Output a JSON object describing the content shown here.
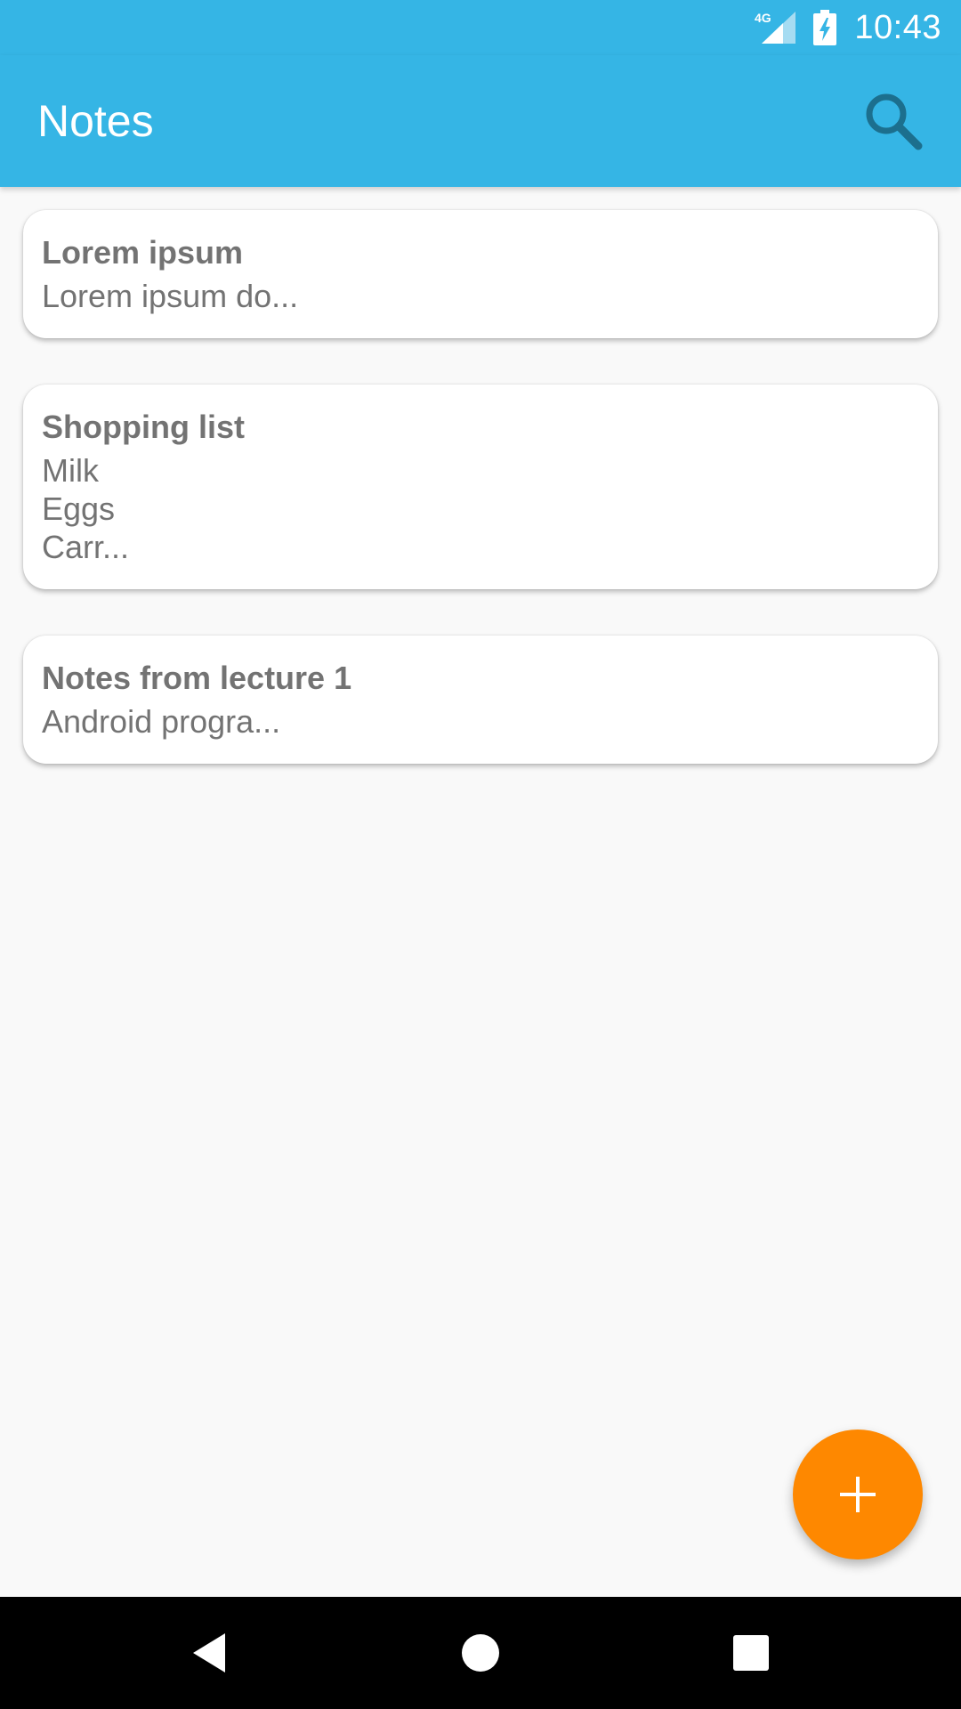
{
  "status_bar": {
    "network_label": "4G",
    "time": "10:43"
  },
  "app_bar": {
    "title": "Notes",
    "search_icon": "search-icon"
  },
  "notes": [
    {
      "title": "Lorem ipsum",
      "preview": "Lorem ipsum do..."
    },
    {
      "title": "Shopping list",
      "preview": "Milk\nEggs\nCarr..."
    },
    {
      "title": "Notes from lecture 1",
      "preview": "Android progra..."
    }
  ],
  "fab": {
    "icon": "plus-icon"
  },
  "nav_bar": {
    "back_icon": "back-icon",
    "home_icon": "home-icon",
    "recents_icon": "recents-icon"
  },
  "colors": {
    "primary": "#35b5e5",
    "accent": "#fe8800",
    "background": "#f9f9f9",
    "card": "#ffffff",
    "note_text": "#737373"
  }
}
